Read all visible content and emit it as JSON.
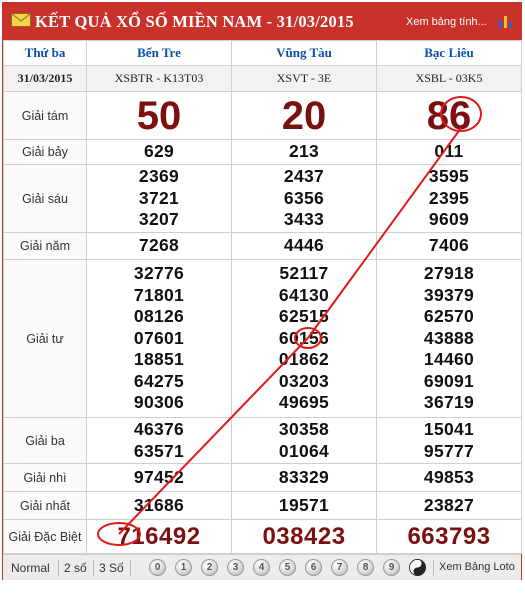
{
  "header": {
    "title": "KẾT QUẢ XỔ SỐ MIỀN NAM - 31/03/2015",
    "chart_link": "Xem bảng tính...",
    "colors": {
      "brand_red": "#c8322b",
      "number_red": "#7a1010",
      "header_blue": "#0b4fa6"
    }
  },
  "table": {
    "day": "Thứ ba",
    "date": "31/03/2015",
    "provinces": [
      {
        "name": "Bến Tre",
        "code": "XSBTR - K13T03"
      },
      {
        "name": "Vũng Tàu",
        "code": "XSVT - 3E"
      },
      {
        "name": "Bạc Liêu",
        "code": "XSBL - 03K5"
      }
    ],
    "prizes": [
      {
        "label": "Giải tám",
        "values": [
          [
            "50"
          ],
          [
            "20"
          ],
          [
            "86"
          ]
        ]
      },
      {
        "label": "Giải bảy",
        "values": [
          [
            "629"
          ],
          [
            "213"
          ],
          [
            "011"
          ]
        ]
      },
      {
        "label": "Giải sáu",
        "values": [
          [
            "2369",
            "3721",
            "3207"
          ],
          [
            "2437",
            "6356",
            "3433"
          ],
          [
            "3595",
            "2395",
            "9609"
          ]
        ]
      },
      {
        "label": "Giải năm",
        "values": [
          [
            "7268"
          ],
          [
            "4446"
          ],
          [
            "7406"
          ]
        ]
      },
      {
        "label": "Giải tư",
        "values": [
          [
            "32776",
            "71801",
            "08126",
            "07601",
            "18851",
            "64275",
            "90306"
          ],
          [
            "52117",
            "64130",
            "62515",
            "60156",
            "01862",
            "03203",
            "49695"
          ],
          [
            "27918",
            "39379",
            "62570",
            "43888",
            "14460",
            "69091",
            "36719"
          ]
        ]
      },
      {
        "label": "Giải ba",
        "values": [
          [
            "46376",
            "63571"
          ],
          [
            "30358",
            "01064"
          ],
          [
            "15041",
            "95777"
          ]
        ]
      },
      {
        "label": "Giải nhì",
        "values": [
          [
            "97452"
          ],
          [
            "83329"
          ],
          [
            "49853"
          ]
        ]
      },
      {
        "label": "Giải nhất",
        "values": [
          [
            "31686"
          ],
          [
            "19571"
          ],
          [
            "23827"
          ]
        ]
      },
      {
        "label": "Giải Đặc Biệt",
        "values": [
          [
            "716492"
          ],
          [
            "038423"
          ],
          [
            "663793"
          ]
        ]
      }
    ]
  },
  "footer": {
    "modes": [
      "Normal",
      "2 số",
      "3 Số"
    ],
    "digits": [
      "0",
      "1",
      "2",
      "3",
      "4",
      "5",
      "6",
      "7",
      "8",
      "9"
    ],
    "loto_link": "Xem Bảng Loto"
  }
}
